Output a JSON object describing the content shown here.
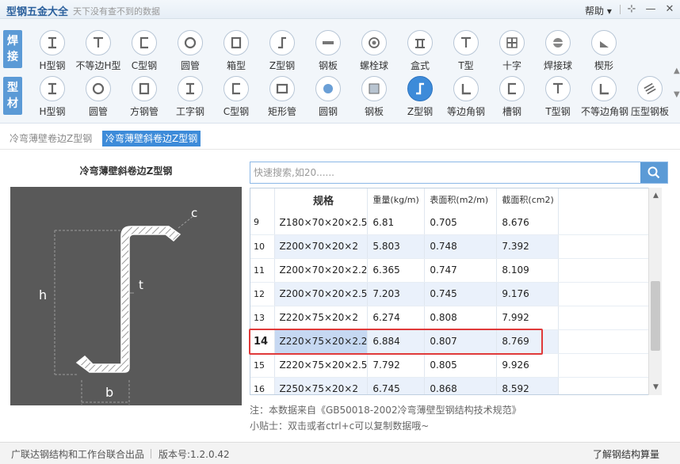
{
  "window": {
    "title": "型钢五金大全",
    "slogan": "天下没有查不到的数据",
    "help_label": "帮助",
    "help_icon": "▾",
    "pin_icon": "⊹",
    "min_icon": "—",
    "close_icon": "✕"
  },
  "toolbar": {
    "row1_label": "焊接",
    "row2_label": "型材",
    "row1": [
      "H型钢",
      "不等边H型",
      "C型钢",
      "圆管",
      "箱型",
      "Z型钢",
      "钢板",
      "螺栓球",
      "盒式",
      "T型",
      "十字",
      "焊接球",
      "楔形"
    ],
    "row2": [
      "H型钢",
      "圆管",
      "方钢管",
      "工字钢",
      "C型钢",
      "矩形管",
      "圆钢",
      "钢板",
      "Z型钢",
      "等边角钢",
      "槽钢",
      "T型钢",
      "不等边角钢",
      "压型钢板"
    ],
    "active_row2": "Z型钢",
    "arrow_up": "▲",
    "arrow_down": "▼"
  },
  "subtabs": [
    "冷弯薄壁卷边Z型钢",
    "冷弯薄壁斜卷边Z型钢"
  ],
  "active_subtab": "冷弯薄壁斜卷边Z型钢",
  "diagram": {
    "title": "冷弯薄壁斜卷边Z型钢",
    "label_h": "h",
    "label_t": "t",
    "label_b": "b",
    "label_c": "c"
  },
  "search": {
    "placeholder": "快速搜索,如20......",
    "icon": "search-icon"
  },
  "table": {
    "headers": [
      "",
      "规格",
      "重量(kg/m)",
      "表面积(m2/m)",
      "截面积(cm2)"
    ],
    "rows": [
      {
        "idx": "9",
        "spec": "Z180×70×20×2.5",
        "weight": "6.81",
        "surface": "0.705",
        "area": "8.676"
      },
      {
        "idx": "10",
        "spec": "Z200×70×20×2",
        "weight": "5.803",
        "surface": "0.748",
        "area": "7.392"
      },
      {
        "idx": "11",
        "spec": "Z200×70×20×2.2",
        "weight": "6.365",
        "surface": "0.747",
        "area": "8.109"
      },
      {
        "idx": "12",
        "spec": "Z200×70×20×2.5",
        "weight": "7.203",
        "surface": "0.745",
        "area": "9.176"
      },
      {
        "idx": "13",
        "spec": "Z220×75×20×2",
        "weight": "6.274",
        "surface": "0.808",
        "area": "7.992"
      },
      {
        "idx": "14",
        "spec": "Z220×75×20×2.2",
        "weight": "6.884",
        "surface": "0.807",
        "area": "8.769"
      },
      {
        "idx": "15",
        "spec": "Z220×75×20×2.5",
        "weight": "7.792",
        "surface": "0.805",
        "area": "9.926"
      },
      {
        "idx": "16",
        "spec": "Z250×75×20×2",
        "weight": "6.745",
        "surface": "0.868",
        "area": "8.592"
      }
    ],
    "selected_idx": "14",
    "scroll_up": "▲",
    "scroll_down": "▼"
  },
  "notes": {
    "source": "注：本数据来自《GB50018-2002冷弯薄壁型钢结构技术规范》",
    "tip": "小贴士：双击或者ctrl+c可以复制数据哦~"
  },
  "footer": {
    "publisher": "广联达钢结构和工作台联合出品",
    "version": "版本号:1.2.0.42",
    "link": "了解钢结构算量"
  },
  "colors": {
    "accent": "#3d8bd9",
    "highlight": "#e03a3a",
    "diagram_bg": "#595959"
  }
}
